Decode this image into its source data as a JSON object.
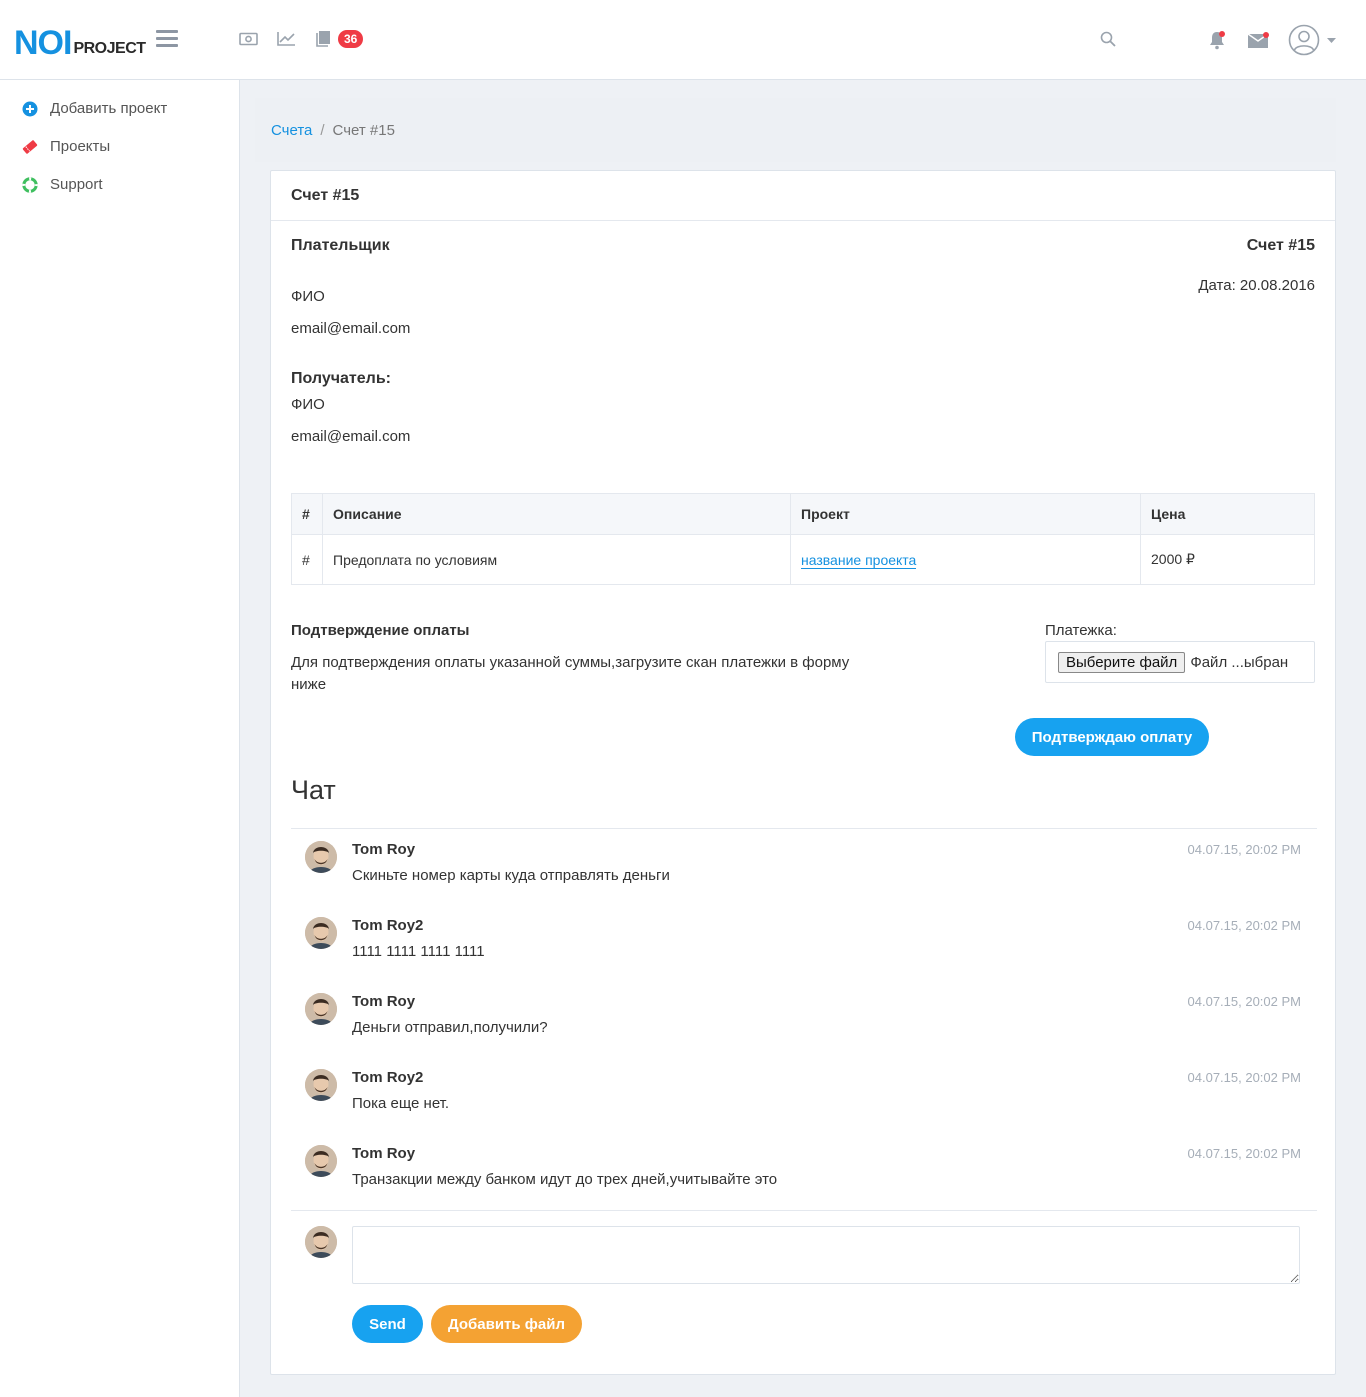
{
  "logo": {
    "main": "NOI",
    "sub": "PROJECT"
  },
  "header": {
    "badge_count": "36"
  },
  "sidebar": {
    "items": [
      {
        "label": "Добавить проект",
        "icon": "plus-circle-icon",
        "color": "#1591e0"
      },
      {
        "label": "Проекты",
        "icon": "ticket-icon",
        "color": "#ef3b45"
      },
      {
        "label": "Support",
        "icon": "lifebuoy-icon",
        "color": "#3fbf5f"
      }
    ]
  },
  "breadcrumb": {
    "parent": "Счета",
    "separator": "/",
    "current": "Счет #15"
  },
  "invoice": {
    "card_title": "Счет #15",
    "payer_heading": "Плательщик",
    "payer_name": "ФИО",
    "payer_email": "email@email.com",
    "recipient_heading": "Получатель:",
    "recipient_name": "ФИО",
    "recipient_email": "email@email.com",
    "number": "Счет #15",
    "date": "Дата: 20.08.2016",
    "table": {
      "headers": [
        "#",
        "Описание",
        "Проект",
        "Цена"
      ],
      "rows": [
        {
          "num": "#",
          "description": "Предоплата по условиям",
          "project": "название проекта",
          "price": "2000 ₽"
        }
      ]
    },
    "confirm_heading": "Подтверждение оплаты",
    "confirm_text": "Для подтверждения оплаты указанной суммы,загрузите скан платежки в форму ниже",
    "file_label": "Платежка:",
    "file_button": "Выберите файл",
    "file_status": "Файл ...ыбран",
    "confirm_button": "Подтверждаю оплату"
  },
  "chat": {
    "title": "Чат",
    "messages": [
      {
        "author": "Tom Roy",
        "time": "04.07.15, 20:02 PM",
        "text": "Скиньте номер карты куда отправлять деньги"
      },
      {
        "author": "Tom Roy2",
        "time": "04.07.15, 20:02 PM",
        "text": "1111 1111 1111 1111"
      },
      {
        "author": "Tom Roy",
        "time": "04.07.15, 20:02 PM",
        "text": "Деньги отправил,получили?"
      },
      {
        "author": "Tom Roy2",
        "time": "04.07.15, 20:02 PM",
        "text": "Пока еще нет."
      },
      {
        "author": "Tom Roy",
        "time": "04.07.15, 20:02 PM",
        "text": "Транзакции между банком идут до трех дней,учитывайте это"
      }
    ],
    "send_button": "Send",
    "add_file_button": "Добавить файл"
  },
  "colors": {
    "accent": "#17a2f0",
    "orange": "#f4a233",
    "badge": "#ef3b45"
  }
}
